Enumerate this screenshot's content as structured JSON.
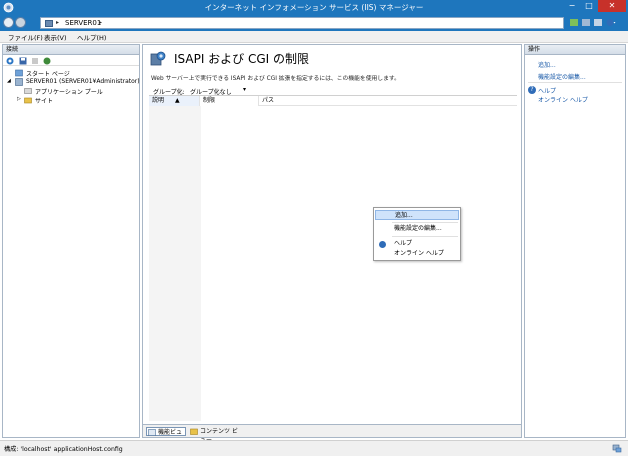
{
  "window": {
    "title": "インターネット インフォメーション サービス (IIS) マネージャー",
    "controls": {
      "minimize": "−",
      "maximize": "□",
      "close": "✕"
    }
  },
  "address": {
    "path": "SERVER01",
    "sep": "▸"
  },
  "menu": [
    "ファイル(F)",
    "表示(V)",
    "ヘルプ(H)"
  ],
  "connections": {
    "header": "接続",
    "tree": [
      {
        "label": "スタート ページ"
      },
      {
        "label": "SERVER01 (SERVER01¥Administrator)"
      },
      {
        "label": "アプリケーション プール"
      },
      {
        "label": "サイト"
      }
    ]
  },
  "feature": {
    "title": "ISAPI および CGI の制限",
    "description": "Web サーバー上で実行できる ISAPI および CGI 拡張を指定するには、この機能を使用します。",
    "group_by_label": "グループ化:",
    "group_by_value": "グループ化なし",
    "columns": [
      "説明",
      "制限",
      "パス"
    ]
  },
  "tabs": {
    "features_view": "機能ビュー",
    "content_view": "コンテンツ ビュー"
  },
  "actions": {
    "header": "操作",
    "add": "追加...",
    "edit_settings": "機能設定の編集...",
    "help": "ヘルプ",
    "online_help": "オンライン ヘルプ"
  },
  "context_menu": {
    "add": "追加...",
    "edit_settings": "機能設定の編集...",
    "help": "ヘルプ",
    "online_help": "オンライン ヘルプ"
  },
  "status": {
    "text": "構成: 'localhost' applicationHost.config"
  },
  "colors": {
    "titlebar": "#1e76bd",
    "close": "#c7312a",
    "link": "#1a5aa8",
    "selection": "#cfe3fb"
  }
}
